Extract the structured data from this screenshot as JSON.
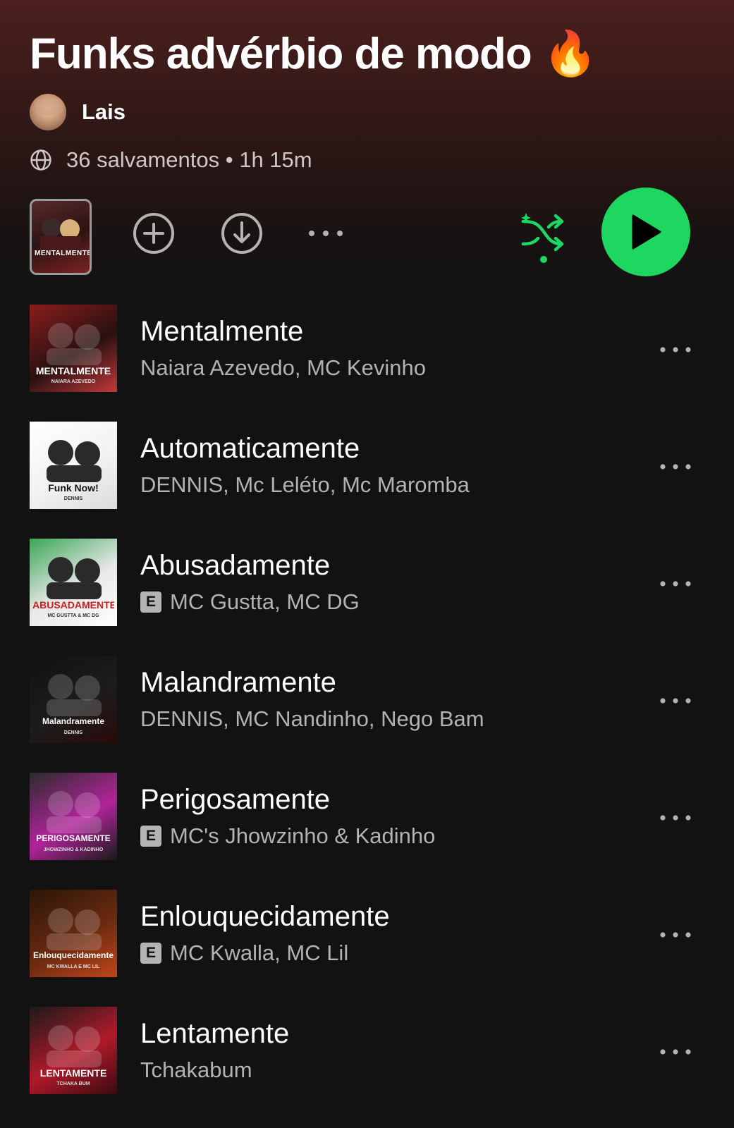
{
  "playlist": {
    "title": "Funks advérbio de modo",
    "title_emoji": "🔥",
    "owner": "Lais",
    "meta": "36 salvamentos • 1h 15m"
  },
  "colors": {
    "accent": "#1ed760",
    "background": "#121212",
    "header_top": "#4a1f1c",
    "secondary_text": "#b3b3b3"
  },
  "controls": {
    "preview_cover_text": "MENTALMENTE",
    "icons": [
      "add-circle-icon",
      "download-icon",
      "more-icon",
      "shuffle-icon",
      "play-icon"
    ]
  },
  "tracks": [
    {
      "title": "Mentalmente",
      "artists": "Naiara Azevedo, MC Kevinho",
      "explicit": false,
      "cover_text": "MENTALMENTE",
      "cover_subtext": "NAIARA AZEVEDO",
      "cover_colors": [
        "#8a1d1d",
        "#2a1010",
        "#c23a3a"
      ]
    },
    {
      "title": "Automaticamente",
      "artists": "DENNIS, Mc Leléto, Mc Maromba",
      "explicit": false,
      "cover_text": "Funk Now!",
      "cover_subtext": "DENNIS",
      "cover_colors": [
        "#ffffff",
        "#f2f2f2",
        "#dcdcdc"
      ]
    },
    {
      "title": "Abusadamente",
      "artists": "MC Gustta, MC DG",
      "explicit": true,
      "cover_text": "ABUSADAMENTE",
      "cover_subtext": "MC GUSTTA & MC DG",
      "cover_colors": [
        "#3aa655",
        "#e8e8e8",
        "#ffffff"
      ]
    },
    {
      "title": "Malandramente",
      "artists": "DENNIS, MC Nandinho, Nego Bam",
      "explicit": false,
      "cover_text": "Malandramente",
      "cover_subtext": "DENNIS",
      "cover_colors": [
        "#111111",
        "#1c1c1c",
        "#2a0a0a"
      ]
    },
    {
      "title": "Perigosamente",
      "artists": "MC's Jhowzinho & Kadinho",
      "explicit": true,
      "cover_text": "PERIGOSAMENTE",
      "cover_subtext": "JHOWZINHO & KADINHO",
      "cover_colors": [
        "#2b2b2b",
        "#b0249a",
        "#1a1a1a"
      ]
    },
    {
      "title": "Enlouquecidamente",
      "artists": "MC Kwalla, MC Lil",
      "explicit": true,
      "cover_text": "Enlouquecidamente",
      "cover_subtext": "MC KWALLA E MC LIL",
      "cover_colors": [
        "#2a1608",
        "#6a2a10",
        "#c0461a"
      ]
    },
    {
      "title": "Lentamente",
      "artists": "Tchakabum",
      "explicit": false,
      "cover_text": "LENTAMENTE",
      "cover_subtext": "TCHAKA BUM",
      "cover_colors": [
        "#1a1a1a",
        "#b01a2a",
        "#3a0a10"
      ]
    }
  ]
}
